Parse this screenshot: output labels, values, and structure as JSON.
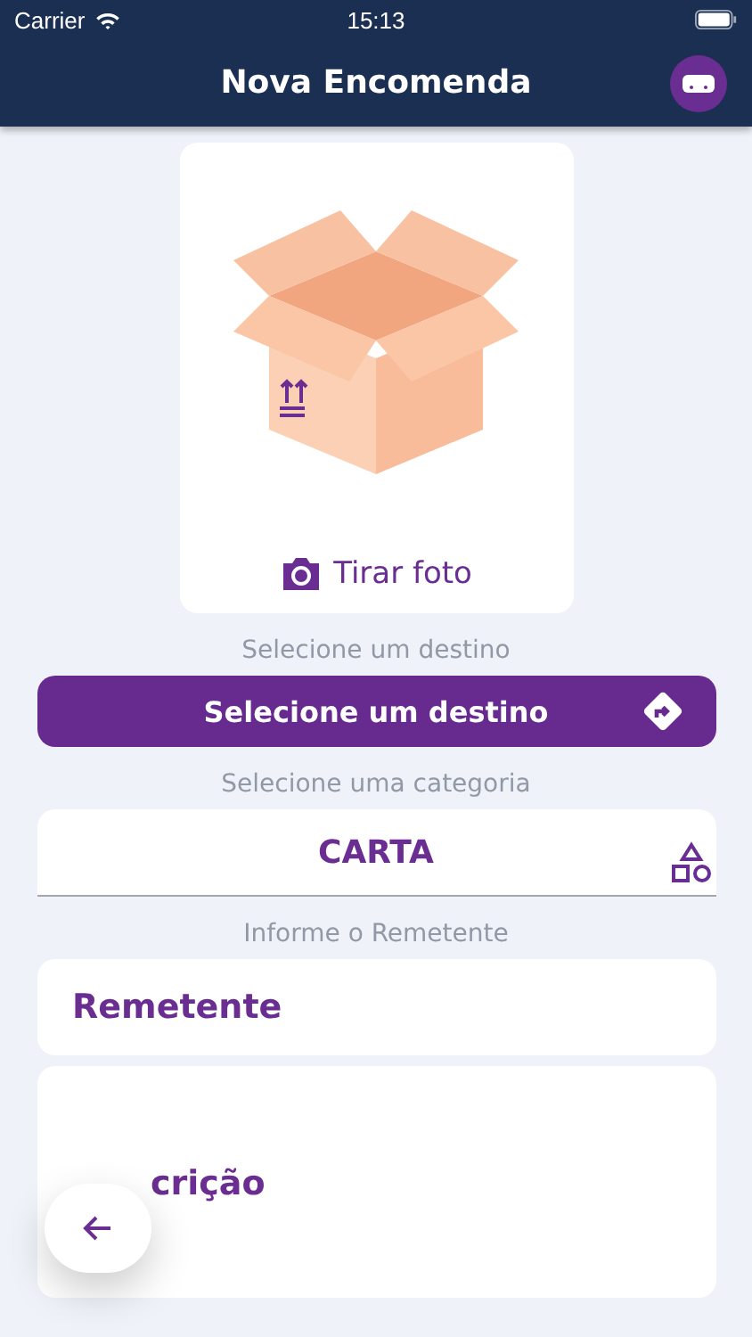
{
  "status_bar": {
    "carrier": "Carrier",
    "time": "15:13"
  },
  "header": {
    "title": "Nova Encomenda"
  },
  "photo": {
    "action": "Tirar foto"
  },
  "destination": {
    "label": "Selecione um destino",
    "button": "Selecione um destino"
  },
  "category": {
    "label": "Selecione uma categoria",
    "value": "CARTA"
  },
  "sender": {
    "label": "Informe o Remetente",
    "placeholder": "Remetente"
  },
  "description": {
    "placeholder": "crição"
  }
}
